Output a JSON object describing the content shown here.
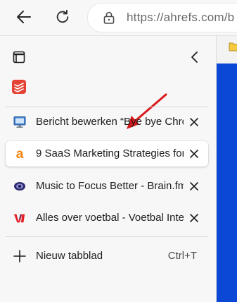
{
  "toolbar": {
    "url": "https://ahrefs.com/b"
  },
  "tabs": [
    {
      "title": "Bericht bewerken “Bye bye Chro",
      "favicon": "wordpress-monitor-icon",
      "active": false
    },
    {
      "title": "9 SaaS Marketing Strategies for",
      "favicon": "ahrefs-logo-icon",
      "active": true
    },
    {
      "title": "Music to Focus Better - Brain.fm",
      "favicon": "brainfm-logo-icon",
      "active": false
    },
    {
      "title": "Alles over voetbal - Voetbal Inte",
      "favicon": "vi-logo-icon",
      "active": false
    }
  ],
  "new_tab": {
    "label": "Nieuw tabblad",
    "shortcut": "Ctrl+T"
  },
  "colors": {
    "annotation_arrow": "#d9191c",
    "page_background": "#0c48d6",
    "ahrefs_orange": "#f3810d"
  }
}
